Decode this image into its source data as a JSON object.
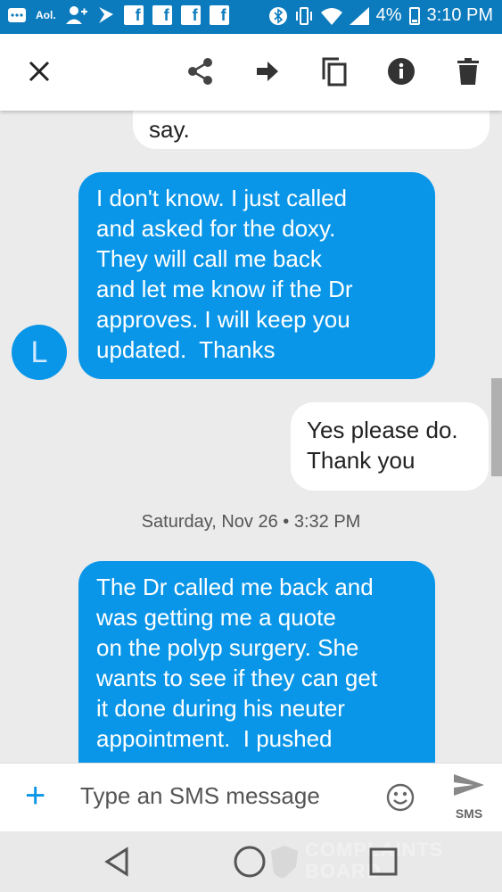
{
  "status_bar": {
    "carrier_badge": "Aol.",
    "battery": "4%",
    "time": "3:10 PM",
    "icons": [
      "more-icon",
      "aol-icon",
      "add-person-icon",
      "sprint-icon",
      "facebook-icon",
      "facebook-icon",
      "facebook-icon",
      "facebook-icon",
      "bluetooth-icon",
      "vibrate-icon",
      "wifi-icon",
      "signal-icon",
      "battery-icon"
    ]
  },
  "toolbar": {
    "actions": [
      "close-icon",
      "share-icon",
      "forward-icon",
      "copy-icon",
      "info-icon",
      "delete-icon"
    ]
  },
  "messages": [
    {
      "direction": "outgoing",
      "lines": [
        "say."
      ]
    },
    {
      "direction": "incoming",
      "sender_initial": "L",
      "lines": [
        "I don't know. I just called",
        "and asked for the doxy.",
        "They will call me back",
        "and let me know if the Dr",
        "approves. I will keep you",
        "updated.  Thanks"
      ]
    },
    {
      "direction": "outgoing",
      "lines": [
        "Yes please do.",
        "Thank you"
      ]
    },
    {
      "direction": "incoming",
      "lines": [
        "The Dr called me back and",
        "was getting me a quote",
        "on the polyp surgery. She",
        "wants to see if they can get",
        "it done during his neuter",
        "appointment.  I pushed"
      ]
    }
  ],
  "date_separator": "Saturday, Nov 26 • 3:32 PM",
  "composer": {
    "placeholder": "Type an SMS message",
    "send_label": "SMS",
    "accent_color": "#0a96e8"
  },
  "watermark": {
    "line1": "COMPLAINTS",
    "line2": "BOARD"
  }
}
